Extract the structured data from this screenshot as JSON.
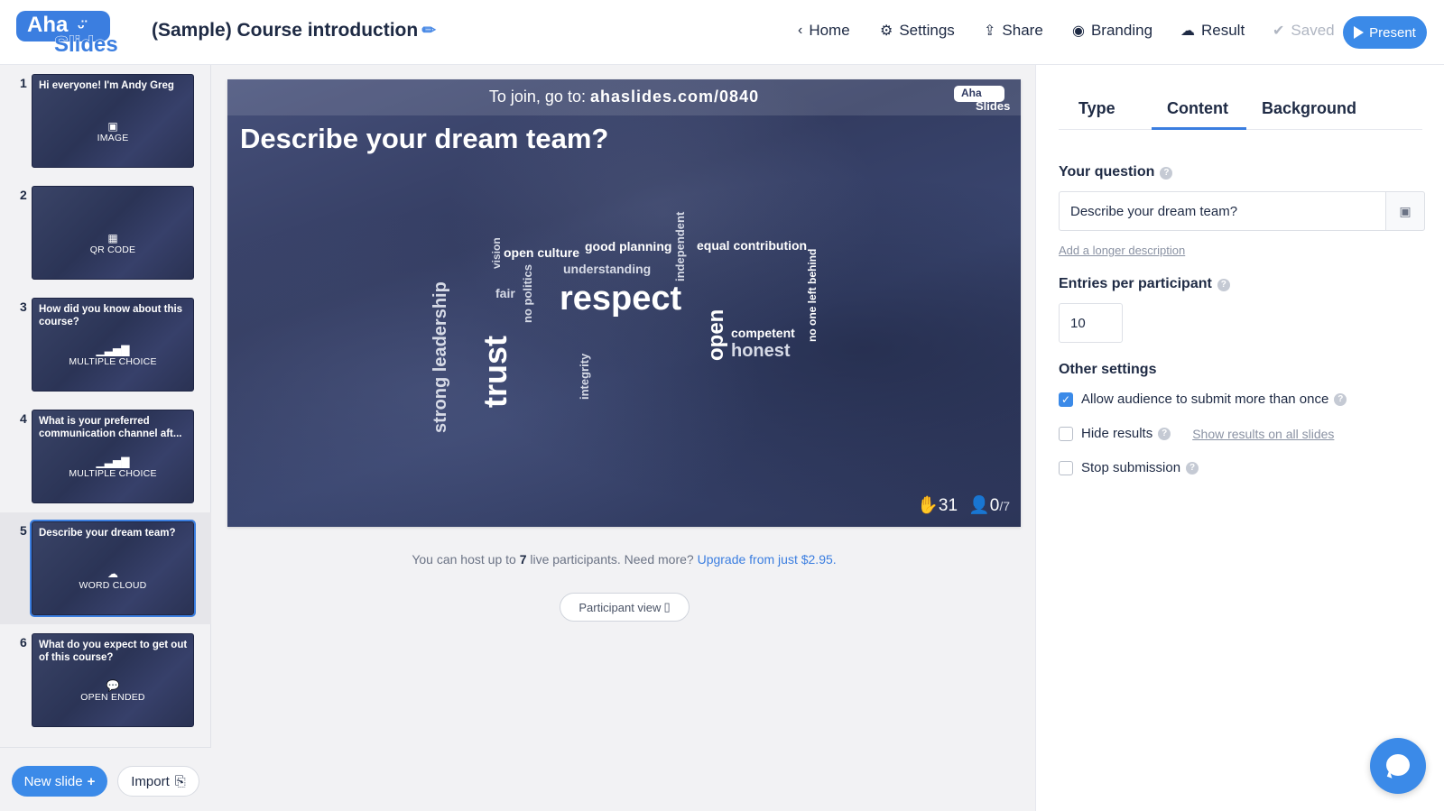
{
  "header": {
    "logo_top": "Aha",
    "logo_bottom": "Slides",
    "presentation_title": "(Sample) Course introduction",
    "nav": [
      {
        "label": "Home",
        "icon": "chevron-left-icon"
      },
      {
        "label": "Settings",
        "icon": "gear-icon"
      },
      {
        "label": "Share",
        "icon": "share-icon"
      },
      {
        "label": "Branding",
        "icon": "palette-icon"
      },
      {
        "label": "Result",
        "icon": "cloud-download-icon"
      },
      {
        "label": "Saved",
        "icon": "check-circle-icon"
      }
    ],
    "present_label": "Present"
  },
  "sidebar": {
    "slides": [
      {
        "num": "1",
        "title": "Hi everyone! I'm Andy Greg",
        "type": "IMAGE",
        "icon": "image-icon"
      },
      {
        "num": "2",
        "title": "",
        "type": "QR CODE",
        "icon": "qr-code-icon"
      },
      {
        "num": "3",
        "title": "How did you know about this course?",
        "type": "MULTIPLE CHOICE",
        "icon": "bar-chart-icon"
      },
      {
        "num": "4",
        "title": "What is your preferred communication channel aft...",
        "type": "MULTIPLE CHOICE",
        "icon": "bar-chart-icon"
      },
      {
        "num": "5",
        "title": "Describe your dream team?",
        "type": "WORD CLOUD",
        "icon": "cloud-icon"
      },
      {
        "num": "6",
        "title": "What do you expect to get out of this course?",
        "type": "OPEN ENDED",
        "icon": "speech-bubble-icon"
      }
    ],
    "active_index": 4,
    "new_slide_label": "New slide",
    "import_label": "Import"
  },
  "stage": {
    "join_prefix": "To join, go to:",
    "join_url": "ahaslides.com/0840",
    "logo_top": "Aha",
    "logo_bottom": "Slides",
    "question": "Describe your dream team?",
    "words": [
      "respect",
      "trust",
      "strong leadership",
      "open",
      "honest",
      "competent",
      "good planning",
      "equal contribution",
      "open culture",
      "understanding",
      "vision",
      "fair",
      "no politics",
      "integrity",
      "independent",
      "no one left behind"
    ],
    "responses_count": "31",
    "participants": "0",
    "participants_max": "/7"
  },
  "host_note": {
    "prefix": "You can host up to",
    "count": "7",
    "middle": "live participants. Need more?",
    "link": "Upgrade from just $2.95."
  },
  "participant_view_label": "Participant view",
  "panel": {
    "tabs": [
      "Type",
      "Content",
      "Background"
    ],
    "active_tab": "Content",
    "question_label": "Your question",
    "question_value": "Describe your dream team?",
    "longer_desc_link": "Add a longer description",
    "entries_label": "Entries per participant",
    "entries_value": "10",
    "other_settings_label": "Other settings",
    "options": [
      {
        "label": "Allow audience to submit more than once",
        "checked": true
      },
      {
        "label": "Hide results",
        "checked": false,
        "link": "Show results on all slides"
      },
      {
        "label": "Stop submission",
        "checked": false
      }
    ]
  },
  "colors": {
    "accent": "#3b8ae8",
    "text": "#1e2a44",
    "stage_bg": "#343d63"
  }
}
